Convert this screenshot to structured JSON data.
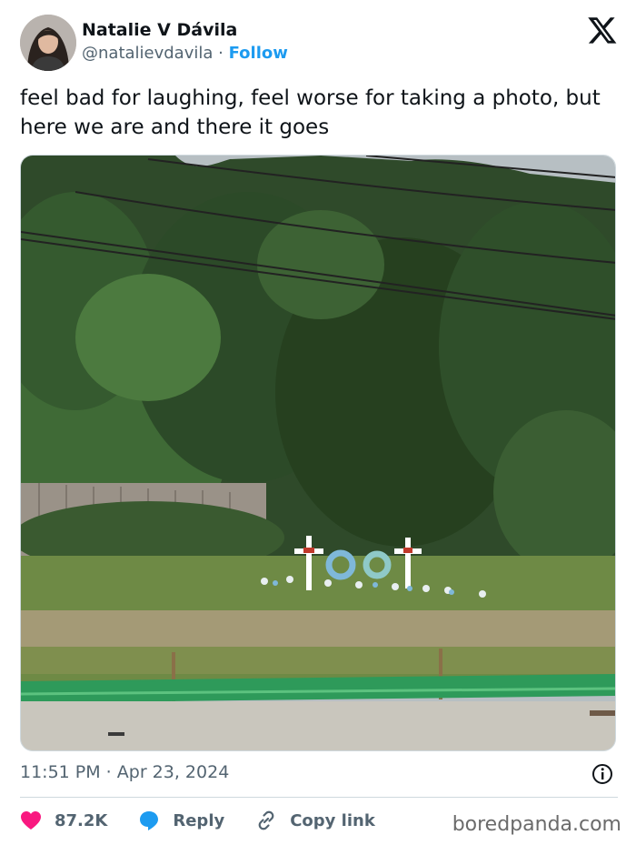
{
  "author": {
    "name": "Natalie V Dávila",
    "handle": "@natalievdavila",
    "separator": "·",
    "follow_label": "Follow"
  },
  "platform_icon": "x-logo-icon",
  "tweet": {
    "text": "feel bad for laughing, feel worse for taking a photo, but here we are and there it goes",
    "timestamp": "11:51 PM · Apr 23, 2024"
  },
  "actions": {
    "like_count": "87.2K",
    "reply_label": "Reply",
    "copy_link_label": "Copy link"
  },
  "watermark": "boredpanda.com",
  "colors": {
    "link": "#1d9bf0",
    "like": "#f91880",
    "secondary_text": "#536471",
    "primary_text": "#0f1419"
  }
}
